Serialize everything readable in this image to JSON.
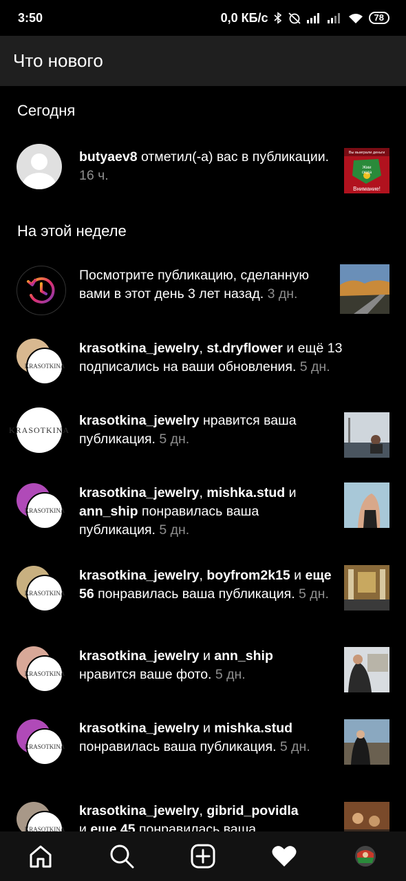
{
  "status_bar": {
    "time": "3:50",
    "network_speed": "0,0 КБ/с",
    "battery": "78"
  },
  "header": {
    "title": "Что нового"
  },
  "sections": {
    "today": "Сегодня",
    "this_week": "На этой неделе"
  },
  "notifications": [
    {
      "bold1": "butyaev8",
      "text": " отметил(-а) вас в публикации.",
      "time": " 16 ч."
    },
    {
      "text": "Посмотрите публикацию, сделанную вами в этот день 3 лет назад.",
      "time": " 3 дн."
    },
    {
      "bold1": "krasotkina_jewelry",
      "sep1": ", ",
      "bold2": "st.dryflower",
      "text": " и ещё 13 подписались на ваши обновления.",
      "time": " 5 дн."
    },
    {
      "bold1": "krasotkina_jewelry",
      "text": " нравится ваша публикация.",
      "time": " 5 дн."
    },
    {
      "bold1": "krasotkina_jewelry",
      "sep1": ", ",
      "bold2": "mishka.stud",
      "sep2": " и ",
      "bold3": "ann_ship",
      "text": " понравилась ваша публикация.",
      "time": " 5 дн."
    },
    {
      "bold1": "krasotkina_jewelry",
      "sep1": ", ",
      "bold2": "boyfrom2k15",
      "sep2": " и ",
      "bold3": "еще 56",
      "text": " понравилась ваша публикация.",
      "time": " 5 дн."
    },
    {
      "bold1": "krasotkina_jewelry",
      "sep1": " и ",
      "bold2": "ann_ship",
      "text": " нравится ваше фото.",
      "time": " 5 дн."
    },
    {
      "bold1": "krasotkina_jewelry",
      "sep1": " и ",
      "bold2": "mishka.stud",
      "text": " понравилась ваша публикация.",
      "time": " 5 дн."
    },
    {
      "bold1": "krasotkina_jewelry",
      "sep1": ", ",
      "bold2": "gibrid_povidla",
      "sep2": " и ",
      "bold3": "еще 45",
      "text": " понравилась ваша",
      "time": ""
    }
  ],
  "thumb1_text": {
    "line1": "Вы выиграли деньги",
    "line2": "Жми",
    "line3": "сюда",
    "line4": "Внимание!"
  },
  "brand_logo": "KRASOTKINA",
  "colors": {
    "background": "#000000",
    "header": "#1f1f1f",
    "secondary_text": "#8e8e8e",
    "bottom_nav": "#121212"
  },
  "nav_icons": [
    "home-icon",
    "search-icon",
    "add-post-icon",
    "heart-icon",
    "profile-avatar"
  ]
}
